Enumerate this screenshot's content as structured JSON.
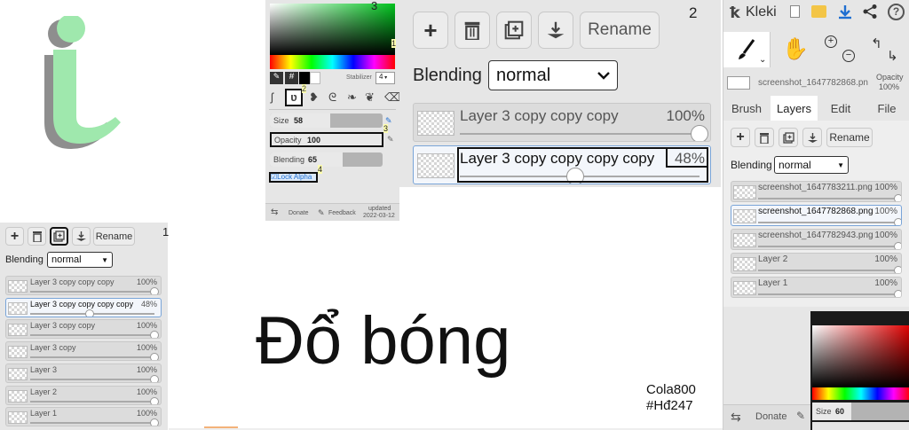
{
  "colors": {
    "accent": "#1f6fd1",
    "panel": "#e6e6e6",
    "letter_green": "#9fe8ad",
    "letter_shadow": "#8e8e8e"
  },
  "main": {
    "title": "Đổ bóng",
    "author": "Cola800",
    "hashtag": "#Hđ247"
  },
  "panel_left": {
    "number": "1",
    "buttons": {
      "add_icon": "plus-icon",
      "delete_icon": "trash-icon",
      "duplicate_icon": "duplicate-icon",
      "merge_icon": "merge-down-icon",
      "rename": "Rename"
    },
    "blending_label": "Blending",
    "blending_value": "normal",
    "layers": [
      {
        "name": "Layer 3 copy copy copy",
        "opacity": "100%",
        "level": 1.0
      },
      {
        "name": "Layer 3 copy copy copy copy",
        "opacity": "48%",
        "level": 0.48,
        "selected": true
      },
      {
        "name": "Layer 3 copy copy",
        "opacity": "100%",
        "level": 1.0
      },
      {
        "name": "Layer 3 copy",
        "opacity": "100%",
        "level": 1.0
      },
      {
        "name": "Layer 3",
        "opacity": "100%",
        "level": 1.0
      },
      {
        "name": "Layer 2",
        "opacity": "100%",
        "level": 1.0
      },
      {
        "name": "Layer 1",
        "opacity": "100%",
        "level": 1.0
      }
    ]
  },
  "panel_tools": {
    "number_top": "3",
    "stabilizer_label": "Stabilizer",
    "stabilizer_value": "4",
    "hex_symbol": "#",
    "badges": [
      "1",
      "2",
      "3",
      "4"
    ],
    "size_label": "Size",
    "size_value": "58",
    "opacity_label": "Opacity",
    "opacity_value": "100",
    "blending_label": "Blending",
    "blending_value": "65",
    "lock_alpha_label": "Lock Alpha",
    "footer": {
      "donate": "Donate",
      "feedback": "Feedback",
      "updated": "updated",
      "date": "2022-03-12"
    }
  },
  "panel_zoom": {
    "number": "2",
    "rename": "Rename",
    "blending_label": "Blending",
    "blending_value": "normal",
    "layers": [
      {
        "name": "Layer 3 copy copy copy",
        "opacity": "100%",
        "level": 1.0
      },
      {
        "name": "Layer 3 copy copy copy copy",
        "opacity": "48%",
        "level": 0.48,
        "selected": true
      }
    ]
  },
  "panel_right": {
    "app_name": "Kleki",
    "top_icons": [
      "new-image-icon",
      "open-folder-icon",
      "download-icon",
      "share-icon",
      "help-icon"
    ],
    "opacity_label": "Opacity",
    "opacity_value": "100%",
    "current_file": "screenshot_1647782868.pn",
    "tabs": [
      "Brush",
      "Layers",
      "Edit",
      "File"
    ],
    "active_tab": "Layers",
    "rename": "Rename",
    "blending_label": "Blending",
    "blending_value": "normal",
    "layers": [
      {
        "name": "screenshot_1647783211.png",
        "opacity": "100%",
        "level": 1.0
      },
      {
        "name": "screenshot_1647782868.png",
        "opacity": "100%",
        "level": 1.0,
        "selected": true
      },
      {
        "name": "screenshot_1647782943.png",
        "opacity": "100%",
        "level": 1.0
      },
      {
        "name": "Layer 2",
        "opacity": "100%",
        "level": 1.0
      },
      {
        "name": "Layer 1",
        "opacity": "100%",
        "level": 1.0
      }
    ],
    "footer": {
      "donate": "Donate"
    },
    "size_label": "Size",
    "size_value": "60"
  }
}
